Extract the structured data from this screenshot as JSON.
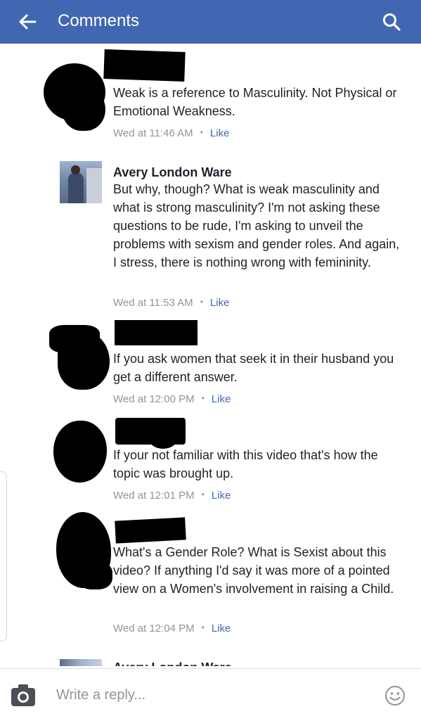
{
  "header": {
    "title": "Comments",
    "background": "#4267b2",
    "back_icon": "back-arrow-icon",
    "search_icon": "search-icon"
  },
  "comments": [
    {
      "author": "",
      "author_redacted": true,
      "text": "Weak is a reference to Masculinity. Not Physical or Emotional Weakness.",
      "time": "Wed at 11:46 AM",
      "like_label": "Like"
    },
    {
      "author": "Avery London Ware",
      "author_redacted": false,
      "text": "But why, though? What is weak masculinity and what is strong masculinity? I'm not asking these questions to be rude, I'm asking to unveil the problems with sexism and gender roles. And again, I stress, there is nothing wrong with femininity.",
      "time": "Wed at 11:53 AM",
      "like_label": "Like"
    },
    {
      "author": "",
      "author_redacted": true,
      "text": "If you ask women that seek it in their husband you get a different answer.",
      "time": "Wed at 12:00 PM",
      "like_label": "Like"
    },
    {
      "author": "",
      "author_redacted": true,
      "text": "If your not familiar with this video that's how the topic was brought up.",
      "time": "Wed at 12:01 PM",
      "like_label": "Like"
    },
    {
      "author": "",
      "author_redacted": true,
      "text": "What's a Gender Role? What is Sexist about this video? If anything I'd say it was more of a pointed view on a Women's involvement in raising a Child.",
      "time": "Wed at 12:04 PM",
      "like_label": "Like"
    },
    {
      "author": "Avery London Ware",
      "author_redacted": false,
      "text": "",
      "time": "",
      "like_label": ""
    }
  ],
  "meta_separator": "•",
  "composer": {
    "placeholder": "Write a reply...",
    "camera_icon": "camera-icon",
    "emoji_icon": "emoji-icon"
  },
  "colors": {
    "link": "#4267b2",
    "meta": "#90949c",
    "text": "#1d2129"
  }
}
